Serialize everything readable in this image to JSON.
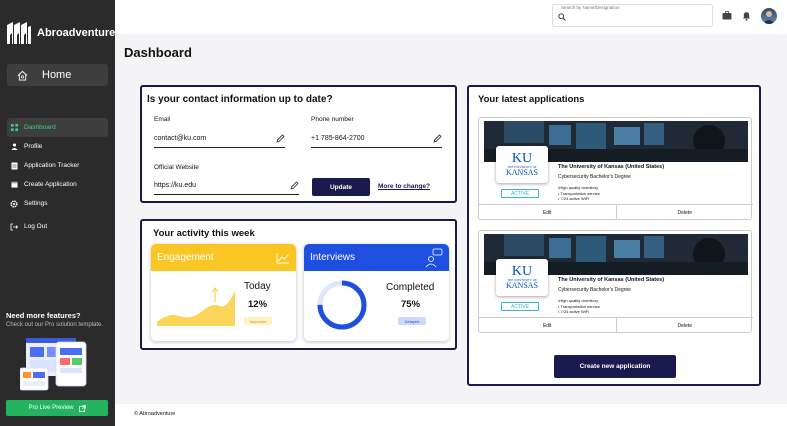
{
  "sidebar": {
    "brand": "Abroadventure",
    "home": "Home",
    "items": [
      {
        "label": "Dashboard",
        "icon": "grid-icon",
        "active": true
      },
      {
        "label": "Profile",
        "icon": "person-icon"
      },
      {
        "label": "Application Tracker",
        "icon": "document-icon"
      },
      {
        "label": "Create Application",
        "icon": "calendar-icon"
      },
      {
        "label": "Settings",
        "icon": "gear-icon"
      },
      {
        "label": "Log Out",
        "icon": "logout-icon"
      }
    ],
    "promo": {
      "title": "Need more features?",
      "subtitle": "Check out our Pro solution template.",
      "button": "Pro Live Preview"
    }
  },
  "topbar": {
    "search_label": "Search by Name/Designation"
  },
  "page_title": "Dashboard",
  "contact": {
    "title": "Is your contact information up to date?",
    "email_label": "Email",
    "email_value": "contact@ku.com",
    "phone_label": "Phone number",
    "phone_value": "+1 785-864-2700",
    "website_label": "Official Website",
    "website_value": "https://ku.edu",
    "update_button": "Update",
    "more_link": "More to change?"
  },
  "activity": {
    "title": "Your activity this week",
    "engagement": {
      "label": "Engagement",
      "period": "Today",
      "value": "12%",
      "pill": "Improved"
    },
    "interviews": {
      "label": "Interviews",
      "status": "Completed",
      "value": "75%",
      "pill": "Delayed",
      "progress": 0.75
    }
  },
  "applications": {
    "title": "Your latest applications",
    "items": [
      {
        "logo_top": "KU",
        "logo_mid": "THE UNIVERSITY OF",
        "logo_bottom": "KANSAS",
        "status": "ACTIVE",
        "name": "The University of Kansas (United States)",
        "degree": "Cybersecurity Bachelor's Degree",
        "bullets": [
          "•High quality dormitory",
          "• Transportation service",
          "• 7/24 active WiFi"
        ],
        "edit": "Edit",
        "delete": "Delete"
      },
      {
        "logo_top": "KU",
        "logo_mid": "THE UNIVERSITY OF",
        "logo_bottom": "KANSAS",
        "status": "ACTIVE",
        "name": "The University of Kansas (United States)",
        "degree": "Cybersecurity Bachelor's Degree",
        "bullets": [
          "•High quality dormitory",
          "• Transportation service",
          "• 7/24 active WiFi"
        ],
        "edit": "Edit",
        "delete": "Delete"
      }
    ],
    "create_button": "Create new application"
  },
  "footer": "© Abroadventure",
  "colors": {
    "sidebar": "#2b2b2b",
    "accent_green": "#3ed081",
    "navy": "#1a1a4e",
    "engagement": "#f9c623",
    "interviews": "#1f4fe0"
  }
}
